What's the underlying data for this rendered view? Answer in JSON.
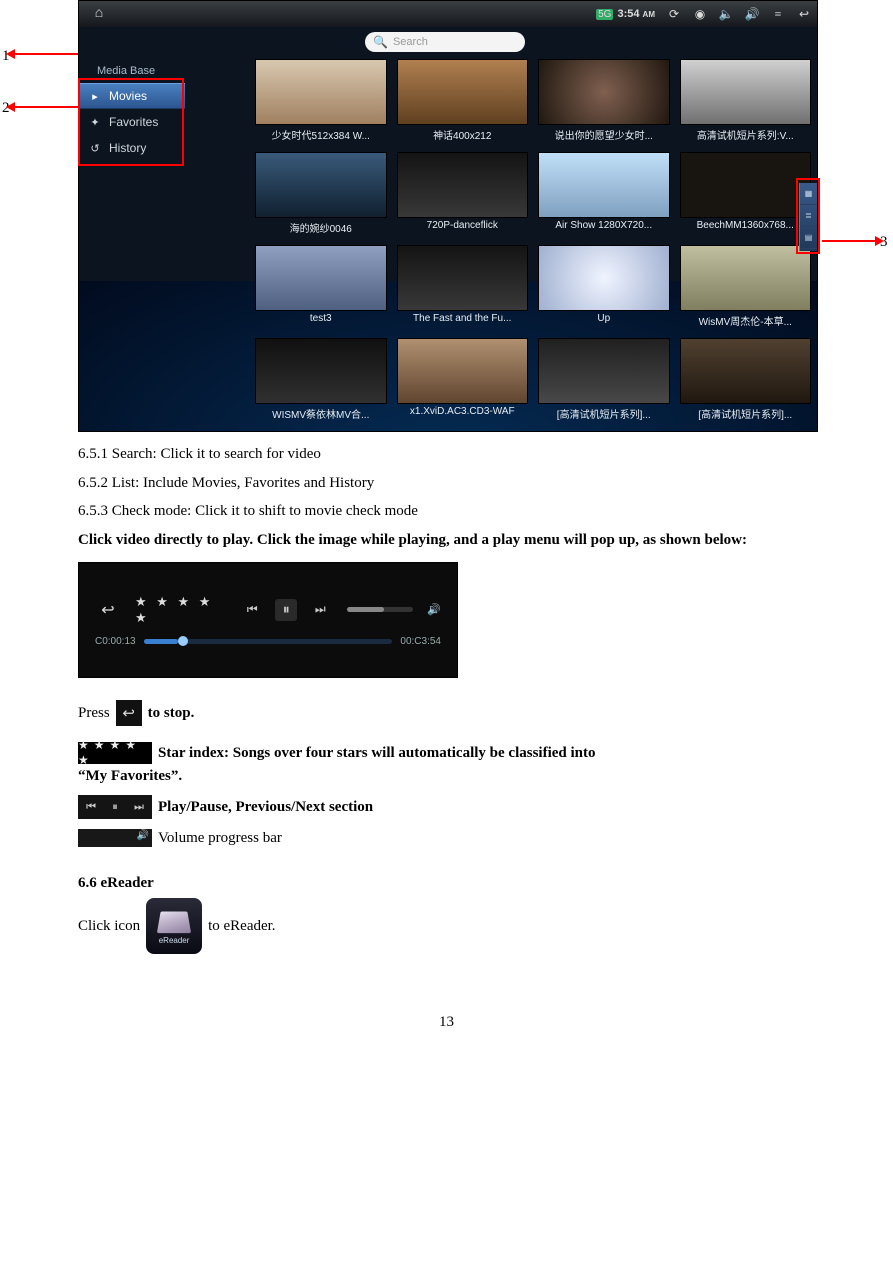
{
  "callouts": {
    "one": "1",
    "two": "2",
    "three": "3"
  },
  "statusbar": {
    "time_badge": "5G",
    "time": "3:54",
    "ampm": "AM"
  },
  "search": {
    "placeholder": "Search"
  },
  "sidebar": {
    "header": "Media Base",
    "items": [
      {
        "label": "Movies"
      },
      {
        "label": "Favorites"
      },
      {
        "label": "History"
      }
    ]
  },
  "tiles": [
    "少女时代512x384 W...",
    "神话400x212",
    "说出你的愿望少女时...",
    "高清试机短片系列:V...",
    "海的婉纱0046",
    "720P-danceflick",
    "Air Show 1280X720...",
    "BeechMM1360x768...",
    "test3",
    "The Fast and the Fu...",
    "Up",
    "WisMV周杰伦-本草...",
    "WISMV蔡依林MV合...",
    "x1.XviD.AC3.CD3-WAF",
    "[高清试机短片系列]...",
    "[高清试机短片系列]..."
  ],
  "player": {
    "current": "C0:00:13",
    "total": "00:C3:54",
    "stars": "★ ★ ★ ★ ★"
  },
  "text": {
    "l651": "6.5.1 Search: Click it to search for video",
    "l652": "6.5.2 List: Include Movies, Favorites and History",
    "l653": "6.5.3 Check mode: Click it to shift to movie check mode",
    "click_play": "Click video directly to play. Click the image while playing, and a play menu will pop up, as shown below:",
    "press": "Press",
    "to_stop": "to stop.",
    "star_index": "Star index: Songs over four stars will automatically be classified into ",
    "my_fav_quote": "“My Favorites”.",
    "play_pause": "Play/Pause, Previous/Next section",
    "vol_bar": "Volume progress bar",
    "ereader_h": "6.6 eReader",
    "click_icon": "Click icon",
    "to_ereader": "to eReader.",
    "ereader_label": "eReader",
    "stars_glyphs": "★ ★ ★ ★ ★"
  },
  "page_number": "13"
}
